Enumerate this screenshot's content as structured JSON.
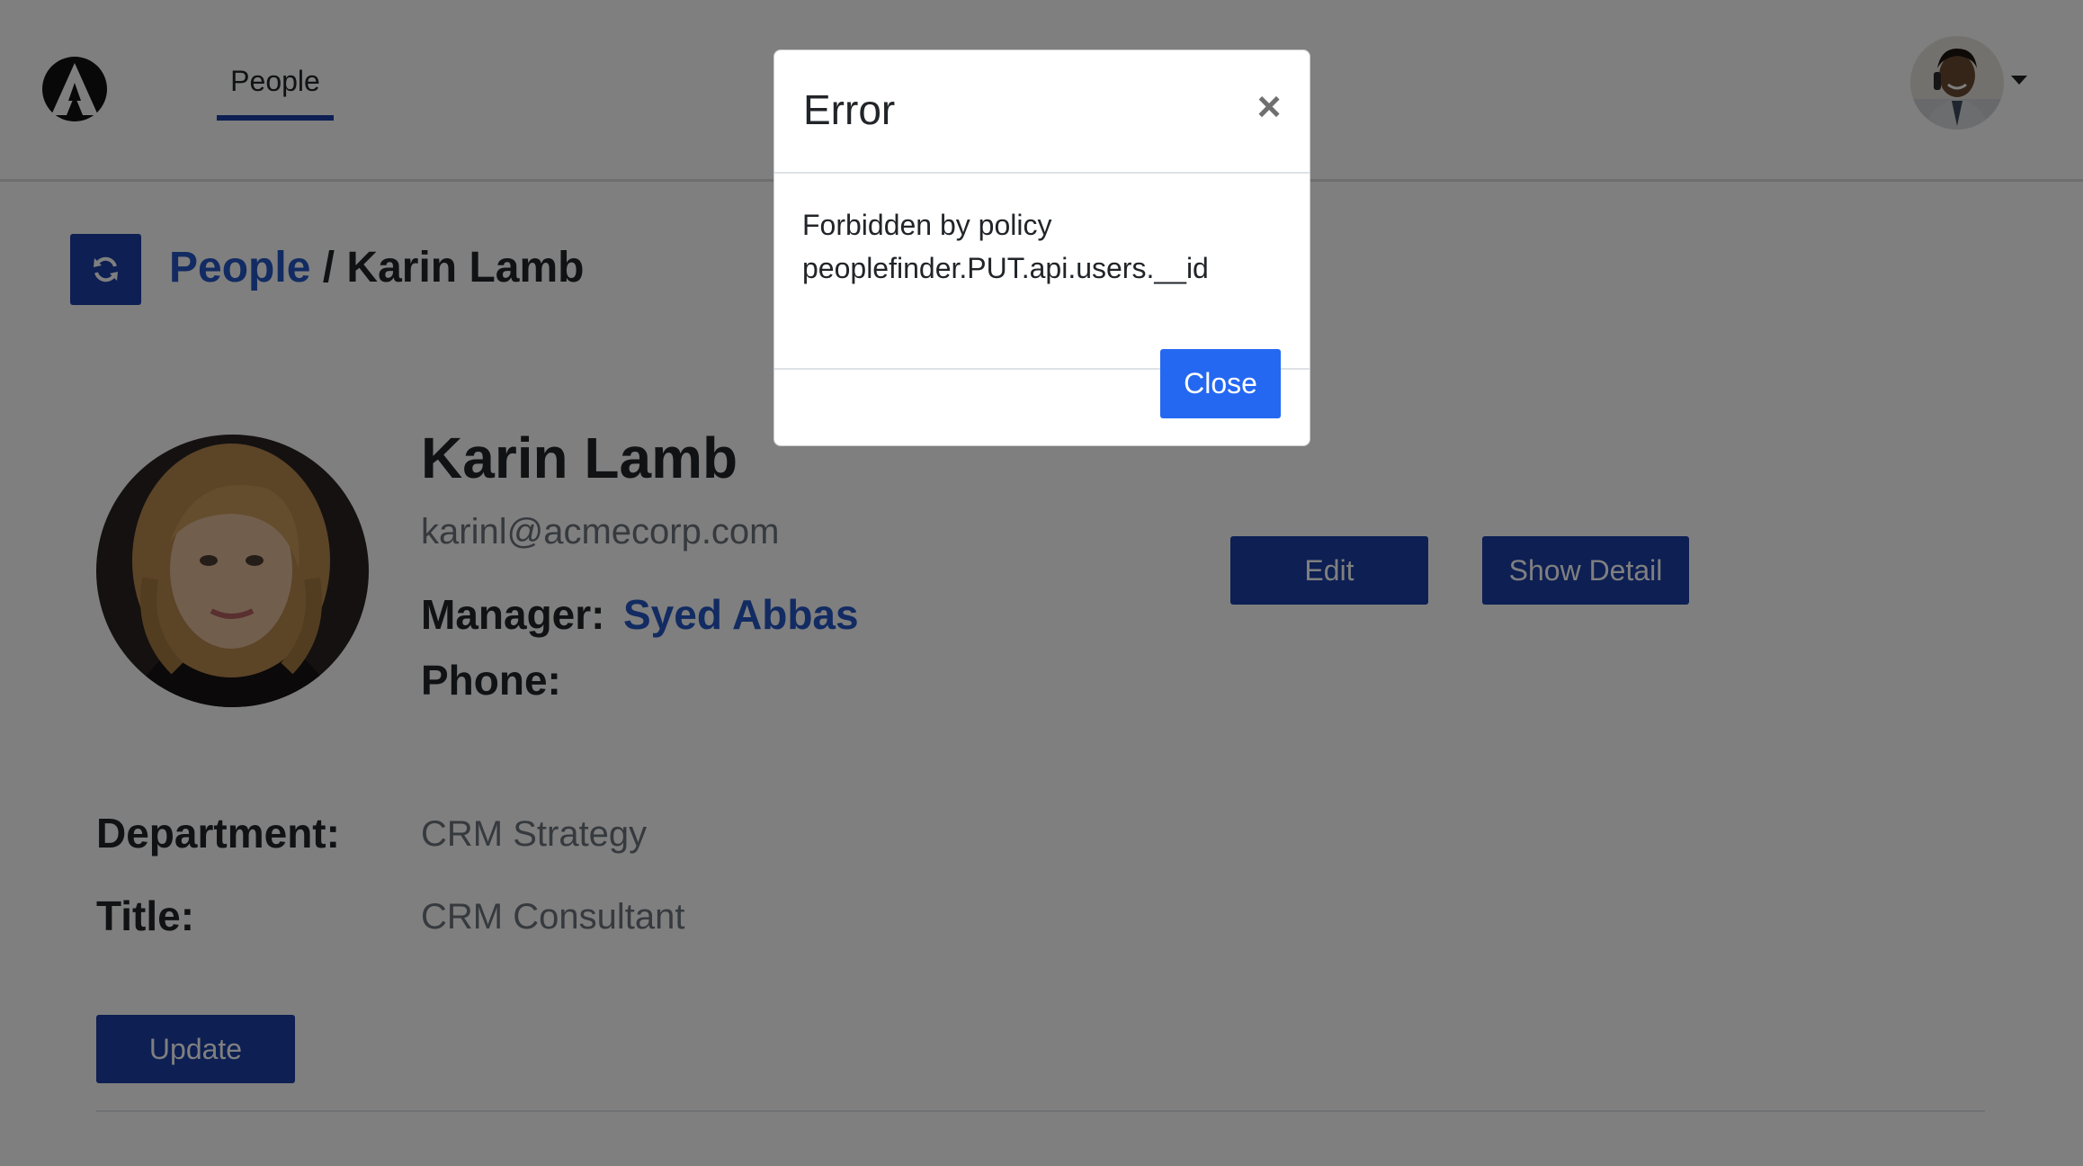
{
  "header": {
    "nav_tab_label": "People"
  },
  "breadcrumb": {
    "parent": "People",
    "separator": " / ",
    "current": "Karin Lamb"
  },
  "profile": {
    "name": "Karin Lamb",
    "email": "karinl@acmecorp.com",
    "manager_label": "Manager:",
    "manager_name": "Syed Abbas",
    "phone_label": "Phone:",
    "department_label": "Department:",
    "department_value": "CRM Strategy",
    "title_label": "Title:",
    "title_value": "CRM Consultant"
  },
  "actions": {
    "edit_label": "Edit",
    "show_detail_label": "Show Detail",
    "update_label": "Update"
  },
  "modal": {
    "title": "Error",
    "close_glyph": "×",
    "message_line1": "Forbidden by policy",
    "message_line2": "peoplefinder.PUT.api.users.__id",
    "close_button_label": "Close"
  },
  "colors": {
    "primary_dark": "#1a3fa6",
    "link_blue": "#2457c5",
    "modal_button": "#2468f2",
    "backdrop": "rgba(0,0,0,0.5)"
  }
}
